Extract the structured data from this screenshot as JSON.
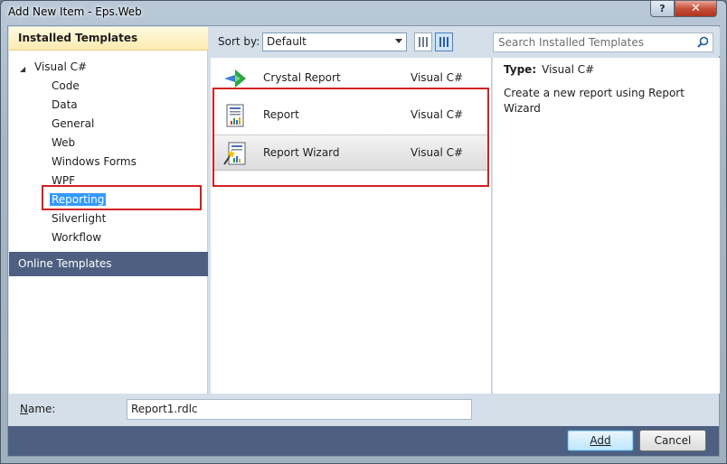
{
  "window": {
    "title": "Add New Item - Eps.Web",
    "help_glyph": "?",
    "close_glyph": "✕"
  },
  "left_panel": {
    "installed_header": "Installed Templates",
    "tree_root": "Visual C#",
    "tree_items": [
      "Code",
      "Data",
      "General",
      "Web",
      "Windows Forms",
      "WPF",
      "Reporting",
      "Silverlight",
      "Workflow"
    ],
    "selected_item": "Reporting",
    "online_header": "Online Templates"
  },
  "toolbar": {
    "sort_label": "Sort by:",
    "sort_value": "Default",
    "search_placeholder": "Search Installed Templates"
  },
  "templates": [
    {
      "name": "Crystal Report",
      "language": "Visual C#",
      "icon": "crystal-report-icon"
    },
    {
      "name": "Report",
      "language": "Visual C#",
      "icon": "report-icon"
    },
    {
      "name": "Report Wizard",
      "language": "Visual C#",
      "icon": "report-wizard-icon",
      "selected": true
    }
  ],
  "details": {
    "type_label": "Type:",
    "type_value": "Visual C#",
    "description": "Create a new report using Report Wizard"
  },
  "footer": {
    "name_label": "Name:",
    "name_value": "Report1.rdlc",
    "add_label": "Add",
    "cancel_label": "Cancel"
  },
  "colors": {
    "selection_blue": "#3399ff",
    "header_navy": "#4d6082",
    "annotation_red": "#d42020"
  }
}
